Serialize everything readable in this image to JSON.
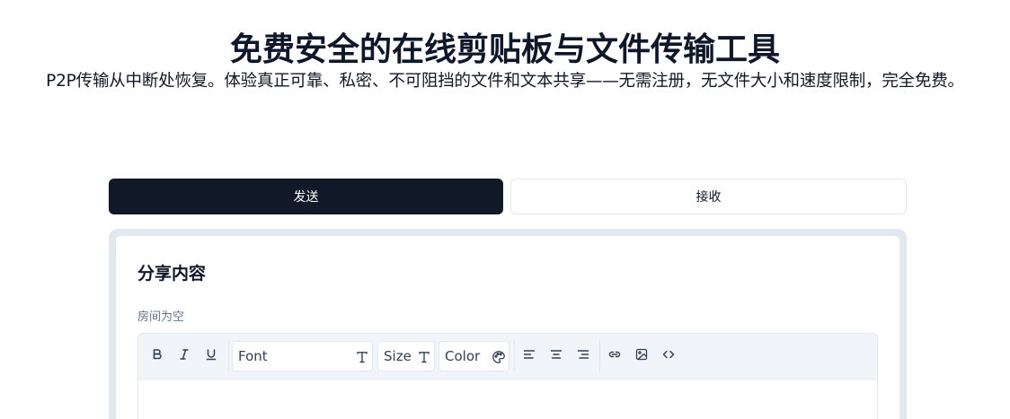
{
  "hero": {
    "title": "免费安全的在线剪贴板与文件传输工具",
    "subtitle": "P2P传输从中断处恢复。体验真正可靠、私密、不可阻挡的文件和文本共享——无需注册，无文件大小和速度限制，完全免费。"
  },
  "tabs": {
    "send_label": "发送",
    "receive_label": "接收",
    "active": "send"
  },
  "panel": {
    "heading": "分享内容",
    "room_status": "房间为空"
  },
  "toolbar": {
    "bold": "B",
    "italic": "I",
    "underline": "U",
    "font_label": "Font",
    "size_label": "Size",
    "color_label": "Color",
    "icons": [
      "bold-icon",
      "italic-icon",
      "underline-icon",
      "text-type-icon",
      "palette-icon",
      "align-left-icon",
      "align-center-icon",
      "align-right-icon",
      "link-icon",
      "image-icon",
      "code-icon"
    ]
  },
  "colors": {
    "active_tab": "#111827",
    "panel_border": "#e2e8f0",
    "toolbar_bg": "#f1f5f9"
  }
}
